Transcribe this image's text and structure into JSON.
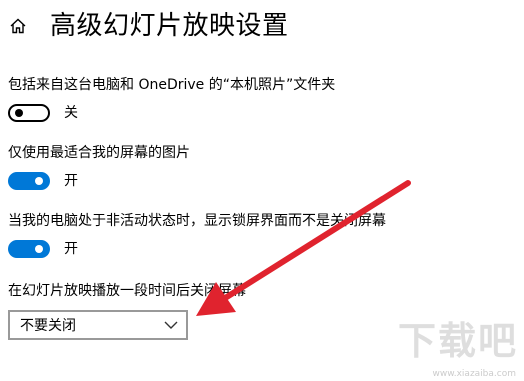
{
  "header": {
    "title": "高级幻灯片放映设置",
    "home_icon": "home-icon"
  },
  "settings": [
    {
      "label": "包括来自这台电脑和 OneDrive 的“本机照片”文件夹",
      "state": "关",
      "on": false
    },
    {
      "label": "仅使用最适合我的屏幕的图片",
      "state": "开",
      "on": true
    },
    {
      "label": "当我的电脑处于非活动状态时，显示锁屏界面而不是关闭屏幕",
      "state": "开",
      "on": true
    }
  ],
  "screen_off": {
    "label": "在幻灯片放映播放一段时间后关闭屏幕",
    "selected": "不要关闭"
  },
  "colors": {
    "accent": "#0078d7",
    "annotation_arrow": "#e0232e"
  },
  "watermark": {
    "logo_text": "下载吧",
    "url": "www.xiazaiba.com"
  }
}
